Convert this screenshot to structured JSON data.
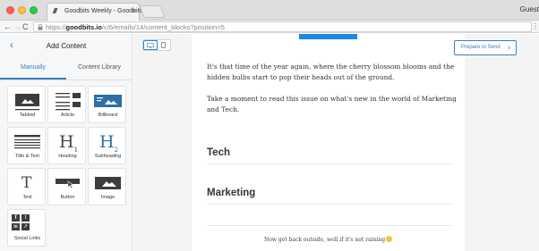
{
  "browser": {
    "tab_title": "Goodbits Weekly - Goodbits",
    "tab_close": "×",
    "favicon_text": "///",
    "profile_name": "Guest",
    "url_prefix": "https://",
    "url_domain": "goodbits.io",
    "url_path": "/c/6/emails/14/content_blocks?position=5",
    "nav_back": "←",
    "nav_forward": "→",
    "nav_reload": "C",
    "menu_glyph": "⋮"
  },
  "sidebar": {
    "back_glyph": "‹",
    "title": "Add Content",
    "tabs": [
      {
        "label": "Manually",
        "active": true
      },
      {
        "label": "Content Library",
        "active": false
      }
    ],
    "blocks": [
      {
        "label": "Tabloid",
        "icon": "tabloid-icon"
      },
      {
        "label": "Article",
        "icon": "article-icon"
      },
      {
        "label": "Billboard",
        "icon": "billboard-icon"
      },
      {
        "label": "Title & Text",
        "icon": "title-text-icon"
      },
      {
        "label": "Heading",
        "icon": "heading-icon",
        "glyph": "H",
        "sub": "1"
      },
      {
        "label": "Subheading",
        "icon": "subheading-icon",
        "glyph": "H",
        "sub": "2"
      },
      {
        "label": "Text",
        "icon": "text-icon",
        "glyph": "T"
      },
      {
        "label": "Button",
        "icon": "button-icon"
      },
      {
        "label": "Image",
        "icon": "image-icon"
      },
      {
        "label": "Social Links",
        "icon": "social-links-icon",
        "glyphs": [
          "f",
          "t",
          "in",
          "↗"
        ]
      }
    ]
  },
  "toolbar": {
    "prepare_label": "Prepare to Send",
    "prepare_chevron": "›"
  },
  "email": {
    "paragraphs": [
      "It's that time of the year again, where the cherry blossom blooms and the hidden bulbs start to pop their heads out of the ground.",
      "Take a moment to read this issue on what's new in the world of Marketing and Tech."
    ],
    "sections": [
      "Tech",
      "Marketing"
    ],
    "footer": "Now get back outside, well if it's not raining"
  },
  "colors": {
    "accent": "#3b7fc4",
    "top_accent": "#1e88e5"
  }
}
